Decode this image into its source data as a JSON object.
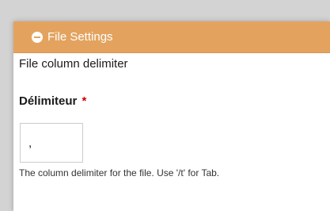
{
  "panel": {
    "title": "File Settings",
    "toggle_icon": "minus-circle-icon",
    "header_color": "#e3a35f"
  },
  "section": {
    "heading": "File column delimiter"
  },
  "delimiter_field": {
    "label": "Délimiteur",
    "required_mark": "*",
    "value": ",",
    "help": "The column delimiter for the file. Use '/t' for Tab."
  }
}
